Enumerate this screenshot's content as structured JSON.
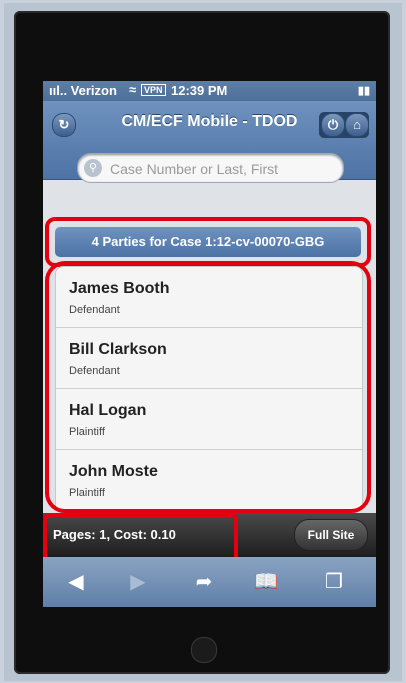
{
  "statusbar": {
    "signal": "ııl.. Verizon",
    "vpn": "VPN",
    "time": "12:39 PM"
  },
  "header": {
    "title": "CM/ECF Mobile - TDOD"
  },
  "search": {
    "placeholder": "Case Number or Last, First"
  },
  "case_info": {
    "text": "4 Parties for Case 1:12-cv-00070-GBG"
  },
  "parties": [
    {
      "name": "James Booth",
      "role": "Defendant"
    },
    {
      "name": "Bill Clarkson",
      "role": "Defendant"
    },
    {
      "name": "Hal Logan",
      "role": "Plaintiff"
    },
    {
      "name": "John Moste",
      "role": "Plaintiff"
    }
  ],
  "footer": {
    "pages_cost": "Pages: 1, Cost: 0.10",
    "full_site_label": "Full Site"
  },
  "colors": {
    "highlight": "#e3000f",
    "header": "#5b7fae"
  },
  "icons": [
    "back-icon",
    "power-icon",
    "home-icon",
    "search-icon",
    "back-arrow-icon",
    "forward-arrow-icon",
    "share-icon",
    "bookmarks-icon",
    "tabs-icon"
  ]
}
